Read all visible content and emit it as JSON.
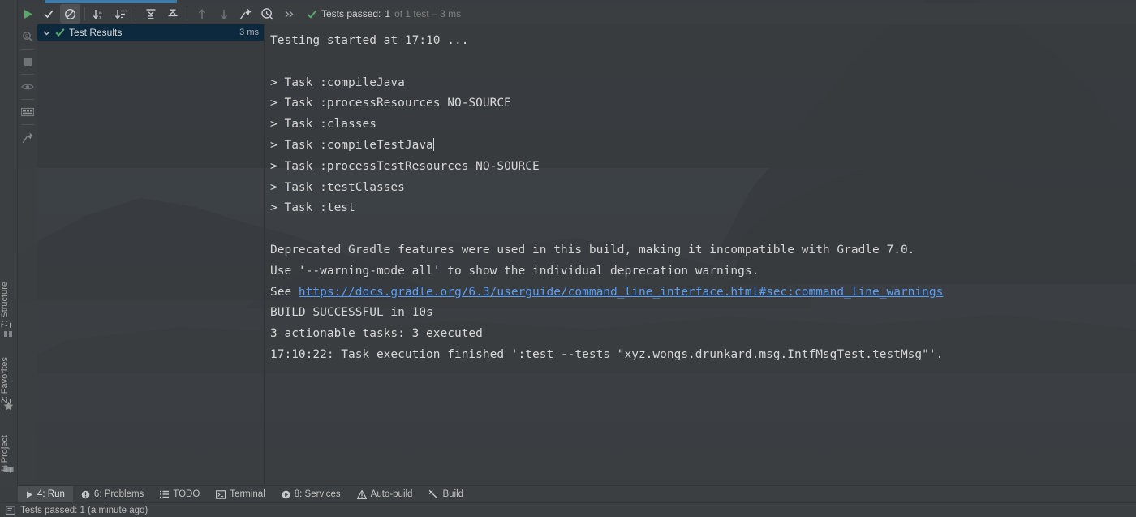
{
  "toolbar": {
    "buttons": [
      {
        "name": "rerun-tests",
        "icon": "play-green",
        "state": "normal"
      },
      {
        "name": "show-passed",
        "icon": "checkmark",
        "state": "normal"
      },
      {
        "name": "show-ignored",
        "icon": "circle-slash",
        "state": "active"
      },
      {
        "name": "sort-alphabetically",
        "icon": "sort-az",
        "state": "normal"
      },
      {
        "name": "sort-by-duration",
        "icon": "sort-duration",
        "state": "normal"
      },
      {
        "name": "expand-all",
        "icon": "expand-all",
        "state": "normal"
      },
      {
        "name": "collapse-all",
        "icon": "collapse-all",
        "state": "normal"
      },
      {
        "name": "previous-failed",
        "icon": "arrow-up",
        "state": "disabled"
      },
      {
        "name": "next-failed",
        "icon": "arrow-down",
        "state": "disabled"
      },
      {
        "name": "pin-tab",
        "icon": "pin",
        "state": "normal"
      },
      {
        "name": "test-history",
        "icon": "clock-search",
        "state": "normal"
      },
      {
        "name": "more-options",
        "icon": "chevron-double-right",
        "state": "normal"
      }
    ],
    "status": {
      "label": "Tests passed:",
      "count": "1",
      "detail": "of 1 test – 3 ms"
    }
  },
  "left_rail": {
    "icons": [
      {
        "name": "debugger-frames-icon",
        "glyph": "9-magnifier"
      },
      {
        "name": "stop-icon",
        "glyph": "square"
      },
      {
        "name": "watch-icon",
        "glyph": "eye"
      },
      {
        "name": "coverage-icon",
        "glyph": "grid"
      },
      {
        "name": "pin-icon",
        "glyph": "pin"
      }
    ]
  },
  "side_labels": [
    {
      "name": "structure",
      "prefix": "7",
      "label": ": Structure",
      "icon": "structure-icon"
    },
    {
      "name": "favorites",
      "prefix": "2",
      "label": ": Favorites",
      "icon": "star-icon"
    },
    {
      "name": "project",
      "prefix": "1",
      "label": ": Project",
      "icon": "folder-icon"
    }
  ],
  "test_tree": {
    "header": {
      "label": "Test Results",
      "duration": "3 ms",
      "expanded": true,
      "status": "passed"
    }
  },
  "console": {
    "lines": [
      {
        "text": "Testing started at 17:10 ...",
        "type": "plain"
      },
      {
        "text": "",
        "type": "blank"
      },
      {
        "text": "> Task :compileJava",
        "type": "plain"
      },
      {
        "text": "> Task :processResources NO-SOURCE",
        "type": "plain"
      },
      {
        "text": "> Task :classes",
        "type": "plain"
      },
      {
        "text": "> Task :compileTestJava",
        "type": "caret"
      },
      {
        "text": "> Task :processTestResources NO-SOURCE",
        "type": "plain"
      },
      {
        "text": "> Task :testClasses",
        "type": "plain"
      },
      {
        "text": "> Task :test",
        "type": "plain"
      },
      {
        "text": "",
        "type": "blank"
      },
      {
        "text": "Deprecated Gradle features were used in this build, making it incompatible with Gradle 7.0.",
        "type": "plain"
      },
      {
        "text": "Use '--warning-mode all' to show the individual deprecation warnings.",
        "type": "plain"
      },
      {
        "text": "See ",
        "type": "link",
        "link": "https://docs.gradle.org/6.3/userguide/command_line_interface.html#sec:command_line_warnings"
      },
      {
        "text": "BUILD SUCCESSFUL in 10s",
        "type": "plain"
      },
      {
        "text": "3 actionable tasks: 3 executed",
        "type": "plain"
      },
      {
        "text": "17:10:22: Task execution finished ':test --tests \"xyz.wongs.drunkard.msg.IntfMsgTest.testMsg\"'.",
        "type": "plain"
      }
    ]
  },
  "bottom_bar": {
    "items": [
      {
        "name": "run",
        "prefix": "4",
        "label": ": Run",
        "icon": "play-icon",
        "selected": true
      },
      {
        "name": "problems",
        "prefix": "6",
        "label": ": Problems",
        "icon": "warning-circle-icon",
        "selected": false
      },
      {
        "name": "todo",
        "prefix": "",
        "label": "TODO",
        "icon": "list-icon",
        "selected": false
      },
      {
        "name": "terminal",
        "prefix": "",
        "label": "Terminal",
        "icon": "terminal-icon",
        "selected": false
      },
      {
        "name": "services",
        "prefix": "8",
        "label": ": Services",
        "icon": "play-circle-icon",
        "selected": false
      },
      {
        "name": "auto-build",
        "prefix": "",
        "label": "Auto-build",
        "icon": "triangle-warning-icon",
        "selected": false
      },
      {
        "name": "build",
        "prefix": "",
        "label": "Build",
        "icon": "hammer-icon",
        "selected": false
      }
    ]
  },
  "status_bar": {
    "icon": "console-icon",
    "text": "Tests passed: 1 (a minute ago)"
  },
  "colors": {
    "accent_blue": "#3d7caa",
    "link_blue": "#589df6",
    "success_green": "#59a869",
    "panel_bg": "#3c3f41",
    "tree_header_bg": "#0d293e",
    "console_text": "#d6d6d6"
  }
}
